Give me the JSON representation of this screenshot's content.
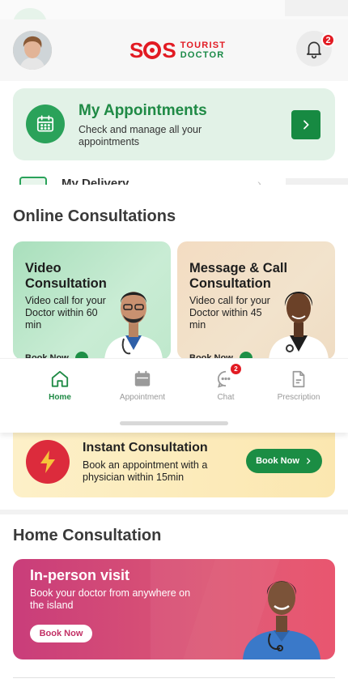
{
  "header": {
    "logo_mark": "SOS",
    "logo_line1": "TOURIST",
    "logo_line2": "DOCTOR",
    "notification_count": "2"
  },
  "appointments_card": {
    "title": "My Appointments",
    "subtitle": "Check and manage all your appointments"
  },
  "peek_row": {
    "label": "My Delivery"
  },
  "online": {
    "title": "Online Consultations",
    "cards": [
      {
        "title": "Video Consultation",
        "desc": "Video call for your Doctor within 60 min",
        "cta": "Book Now"
      },
      {
        "title": "Message & Call Consultation",
        "desc": "Video call for your Doctor within 45 min",
        "cta": "Book Now"
      }
    ]
  },
  "bottom_nav": {
    "items": [
      {
        "label": "Home",
        "icon": "home-icon"
      },
      {
        "label": "Appointment",
        "icon": "calendar-icon"
      },
      {
        "label": "Chat",
        "icon": "chat-icon",
        "badge": "2"
      },
      {
        "label": "Prescription",
        "icon": "document-icon"
      }
    ]
  },
  "instant": {
    "title": "Instant Consultation",
    "subtitle": "Book an appointment  with a physician within 15min",
    "cta": "Book Now"
  },
  "home": {
    "title": "Home Consultation",
    "card": {
      "title": "In-person visit",
      "subtitle": "Book your doctor from anywhere on the island",
      "cta": "Book Now"
    }
  },
  "colors": {
    "brand_green": "#1f8a45",
    "brand_red": "#e21b23",
    "appointment_bg": "#e2f2e7",
    "instant_bg": "#fbe7b0",
    "inperson_bg": "#d94a74"
  }
}
